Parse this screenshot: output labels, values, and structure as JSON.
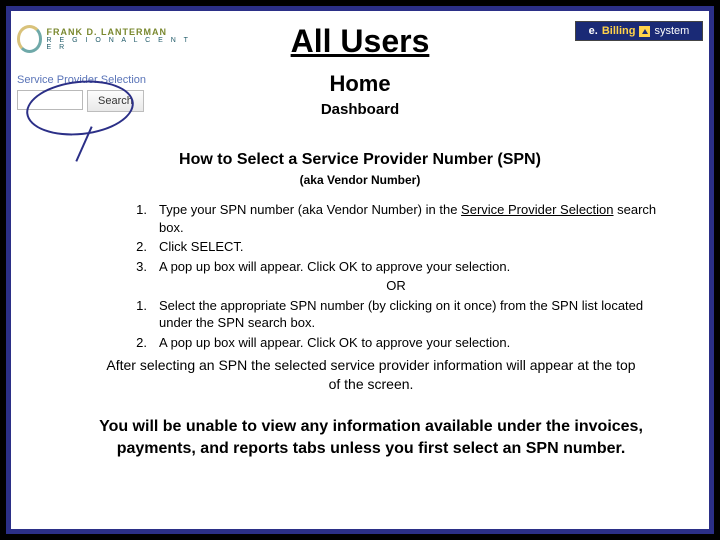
{
  "logo_fdl": {
    "line1": "FRANK D. LANTERMAN",
    "line2": "R E G I O N A L   C E N T E R"
  },
  "logo_eb": {
    "e": "e.",
    "b": "Billing",
    "s": "system"
  },
  "title": "All Users",
  "home": "Home",
  "dashboard": "Dashboard",
  "snippet": {
    "label": "Service Provider Selection",
    "search_value": "",
    "search_btn": "Search"
  },
  "heading": "How to Select a Service Provider Number (SPN)",
  "aka": "(aka Vendor Number)",
  "steps_a": [
    {
      "n": "1.",
      "pre": "Type your SPN number (aka Vendor Number) in the ",
      "u": "Service Provider Selection",
      "post": " search box."
    },
    {
      "n": "2.",
      "t": "Click SELECT."
    },
    {
      "n": "3.",
      "t": "A pop up box will appear. Click OK to approve your selection."
    }
  ],
  "or": "OR",
  "steps_b": [
    {
      "n": "1.",
      "t": "Select the appropriate SPN number (by clicking on it once) from the SPN list located under the SPN search box."
    },
    {
      "n": "2.",
      "t": "A pop up box will appear. Click OK to approve your selection."
    }
  ],
  "after": "After selecting an SPN the selected service provider information will appear at the top of the screen.",
  "warning": "You will be unable to view any information available under the invoices, payments, and reports  tabs unless you first select an SPN number."
}
